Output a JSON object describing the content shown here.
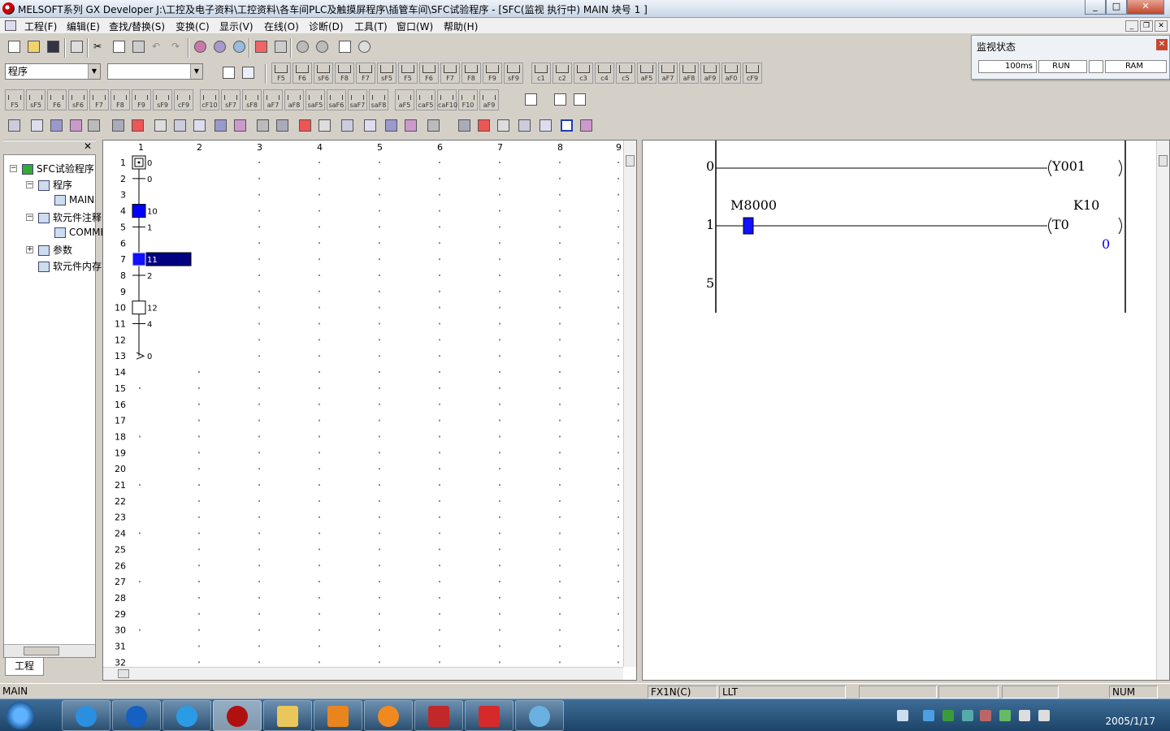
{
  "window": {
    "title": "MELSOFT系列 GX Developer J:\\工控及电子资料\\工控资料\\各车间PLC及触摸屏程序\\插管车间\\SFC试验程序 - [SFC(监视 执行中)    MAIN      块号    1    ]"
  },
  "menu": [
    "工程(F)",
    "编辑(E)",
    "查找/替换(S)",
    "变换(C)",
    "显示(V)",
    "在线(O)",
    "诊断(D)",
    "工具(T)",
    "窗口(W)",
    "帮助(H)"
  ],
  "toolbar": {
    "program_combo": "程序",
    "second_combo": ""
  },
  "sfc_keys_row1": [
    "F5",
    "F6",
    "sF6",
    "F8",
    "F7",
    "sF5",
    "F5",
    "F6",
    "F7",
    "F8",
    "F9",
    "sF9",
    "c1",
    "c2",
    "c3",
    "c4",
    "c5",
    "aF5",
    "aF7",
    "aF8",
    "aF9",
    "aF0",
    "cF9"
  ],
  "ladder_keys_row": [
    "F5",
    "sF5",
    "F6",
    "sF6",
    "F7",
    "F8",
    "F9",
    "sF9",
    "cF9",
    "cF10",
    "sF7",
    "sF8",
    "aF7",
    "aF8",
    "saF5",
    "saF6",
    "saF7",
    "saF8",
    "aF5",
    "caF5",
    "caF10",
    "F10",
    "aF9"
  ],
  "monitor": {
    "title": "监视状态",
    "scan": "100ms",
    "mode": "RUN",
    "memory": "RAM"
  },
  "project_tree": {
    "root": "SFC试验程序",
    "program": "程序",
    "main": "MAIN",
    "device_comment": "软元件注释",
    "comment": "COMMENT",
    "param": "参数",
    "device_mem": "软元件内存",
    "tab": "工程"
  },
  "sfc": {
    "columns": [
      "1",
      "2",
      "3",
      "4",
      "5",
      "6",
      "7",
      "8",
      "9"
    ],
    "rows": [
      "1",
      "2",
      "3",
      "4",
      "5",
      "6",
      "7",
      "8",
      "9",
      "10",
      "11",
      "12",
      "13",
      "14",
      "15",
      "16",
      "17",
      "18",
      "19",
      "20",
      "21",
      "22",
      "23",
      "24",
      "25",
      "26",
      "27",
      "28",
      "29",
      "30",
      "31",
      "32"
    ],
    "labels": {
      "s0": "0",
      "t0": "0",
      "s10": "10",
      "t1": "1",
      "s11": "11",
      "t2": "2",
      "s12": "12",
      "t4": "4",
      "jump": "0"
    }
  },
  "ladder": {
    "step0": "0",
    "coil0": "Y001",
    "contact_label": "M8000",
    "step1": "1",
    "coil1": "T0",
    "k_value": "K10",
    "timer_current": "0",
    "step5": "5"
  },
  "status": {
    "program": "MAIN",
    "plc_type": "FX1N(C)",
    "mode": "LLT",
    "num": "NUM"
  },
  "clock": {
    "date": "2005/1/17"
  },
  "colors": {
    "accent_blue": "#0000ff",
    "selected_step": "#000080"
  }
}
